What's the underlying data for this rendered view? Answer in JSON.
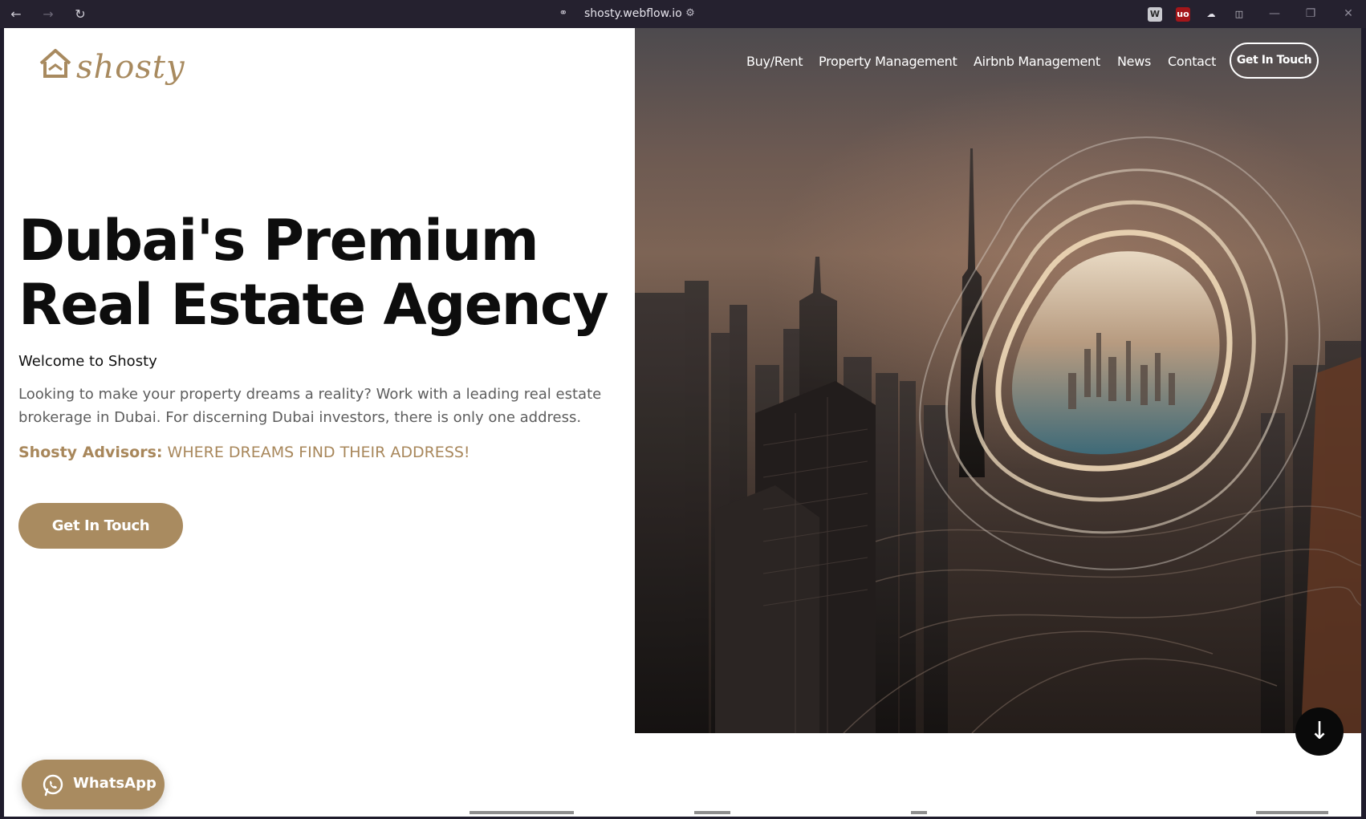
{
  "browser": {
    "url": "shosty.webflow.io",
    "nav": {
      "back": "←",
      "forward": "→",
      "reload": "↻"
    },
    "extensions": [
      {
        "name": "webflow-extension-icon",
        "glyph": "W",
        "bg": "#c9c9cf",
        "fg": "#2a2a2a"
      },
      {
        "name": "ublock-extension-icon",
        "glyph": "uo",
        "bg": "#a4161a",
        "fg": "#ffffff"
      },
      {
        "name": "cloud-extension-icon",
        "glyph": "☁",
        "bg": "transparent",
        "fg": "#e6e4ec"
      },
      {
        "name": "sidebar-toggle-icon",
        "glyph": "◫",
        "bg": "transparent",
        "fg": "#cfcdd6"
      }
    ],
    "window_controls": {
      "minimize": "—",
      "maximize": "❐",
      "close": "✕"
    }
  },
  "site": {
    "logo_text": "shosty",
    "nav": [
      "Buy/Rent",
      "Property Management",
      "Airbnb Management",
      "News",
      "Contact"
    ],
    "nav_cta": "Get In Touch"
  },
  "hero": {
    "title_line1": "Dubai's Premium",
    "title_line2": "Real Estate Agency",
    "welcome": "Welcome to Shosty",
    "lead": "Looking to make your property dreams a reality? Work with a leading real estate brokerage in Dubai. For discerning Dubai investors, there is only one address.",
    "tagline_bold": "Shosty Advisors:",
    "tagline_rest": " WHERE DREAMS FIND THEIR ADDRESS!",
    "cta": "Get In Touch"
  },
  "floating": {
    "scroll_down": "↓",
    "whatsapp": "WhatsApp"
  },
  "colors": {
    "brand_gold": "#a98b60",
    "text_dark": "#0d0d0d",
    "text_muted": "#5d5d5d",
    "chrome_bg": "#25212f"
  }
}
